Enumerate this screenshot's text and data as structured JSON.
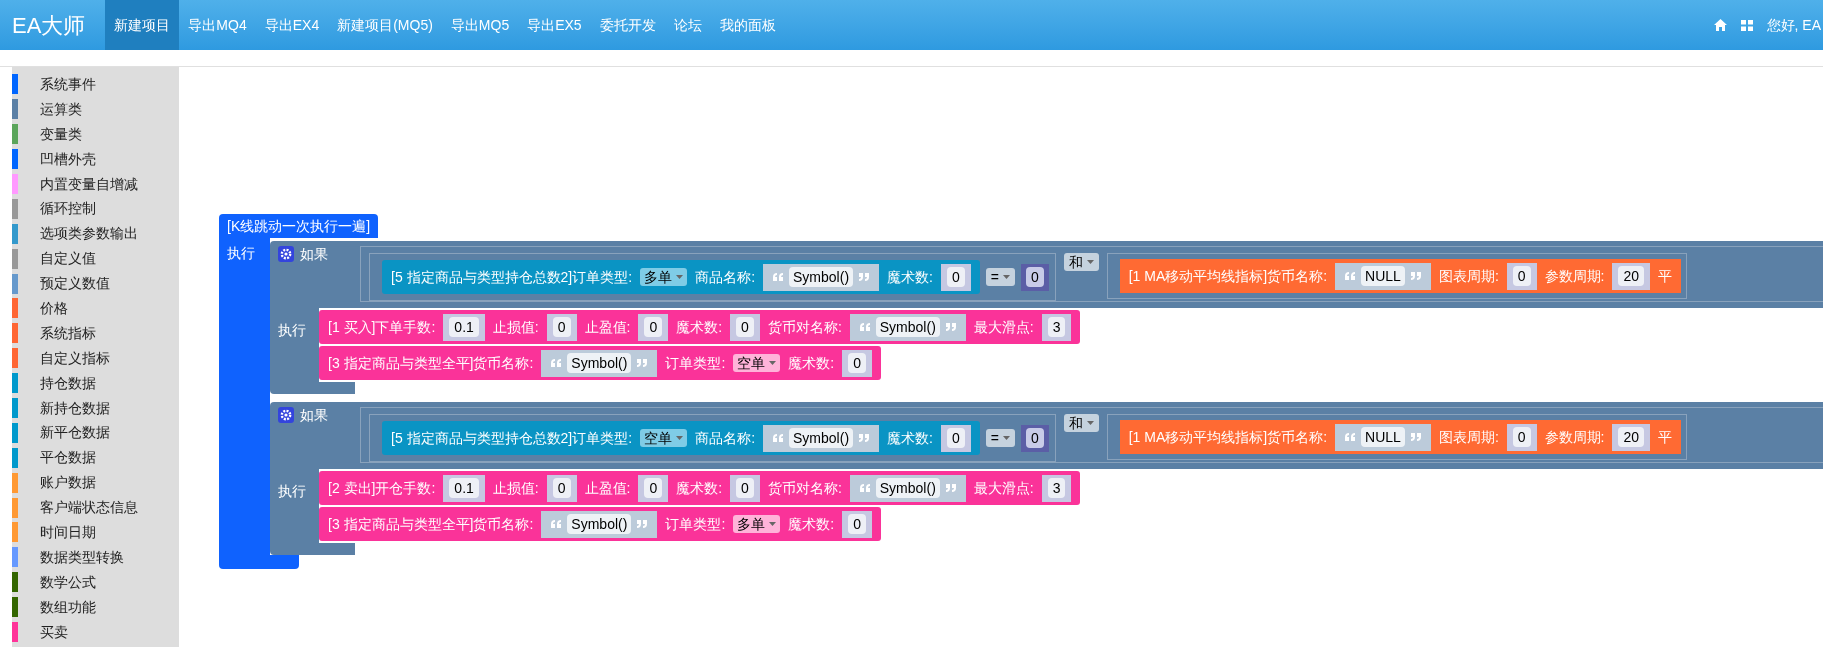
{
  "brand": "EA大师",
  "nav": [
    {
      "label": "新建项目",
      "selected": true
    },
    {
      "label": "导出MQ4",
      "selected": false
    },
    {
      "label": "导出EX4",
      "selected": false
    },
    {
      "label": "新建项目(MQ5)",
      "selected": false
    },
    {
      "label": "导出MQ5",
      "selected": false
    },
    {
      "label": "导出EX5",
      "selected": false
    },
    {
      "label": "委托开发",
      "selected": false
    },
    {
      "label": "论坛",
      "selected": false
    },
    {
      "label": "我的面板",
      "selected": false
    }
  ],
  "greeting": "您好, EA",
  "sidebar": {
    "items": [
      {
        "label": "系统事件",
        "color": "#0066ff"
      },
      {
        "label": "运算类",
        "color": "#5b80a5"
      },
      {
        "label": "变量类",
        "color": "#5ba55b"
      },
      {
        "label": "凹槽外壳",
        "color": "#0066ff"
      },
      {
        "label": "内置变量自增减",
        "color": "#ff99ff"
      },
      {
        "label": "循环控制",
        "color": "#999999"
      },
      {
        "label": "选项类参数输出",
        "color": "#3399cc"
      },
      {
        "label": "自定义值",
        "color": "#999999"
      },
      {
        "label": "预定义数值",
        "color": "#6699cc"
      },
      {
        "label": "价格",
        "color": "#ff6633"
      },
      {
        "label": "系统指标",
        "color": "#ff6633"
      },
      {
        "label": "自定义指标",
        "color": "#ff6633"
      },
      {
        "label": "持仓数据",
        "color": "#0099cc"
      },
      {
        "label": "新持仓数据",
        "color": "#0099cc"
      },
      {
        "label": "新平仓数据",
        "color": "#0099cc"
      },
      {
        "label": "平仓数据",
        "color": "#0099cc"
      },
      {
        "label": "账户数据",
        "color": "#ff9933"
      },
      {
        "label": "客户端状态信息",
        "color": "#ff9933"
      },
      {
        "label": "时间日期",
        "color": "#ff9933"
      },
      {
        "label": "数据类型转换",
        "color": "#6699ff"
      },
      {
        "label": "数学公式",
        "color": "#336600"
      },
      {
        "label": "数组功能",
        "color": "#336600"
      },
      {
        "label": "买卖",
        "color": "#ff3399"
      }
    ]
  },
  "workspace": {
    "event_block": {
      "title": "[K线跳动一次执行一遍]",
      "do_label": "执行",
      "statements": [
        {
          "if_label": "如果",
          "do_label": "执行",
          "condition": {
            "left": {
              "kind": "position",
              "parts": [
                {
                  "kind": "label",
                  "text": "[5 指定商品与类型持仓总数2]订单类型:"
                },
                {
                  "kind": "dropdown",
                  "text": "多单"
                },
                {
                  "kind": "label",
                  "text": "商品名称:"
                },
                {
                  "kind": "string",
                  "text": "Symbol()"
                },
                {
                  "kind": "label",
                  "text": "魔术数:"
                },
                {
                  "kind": "number",
                  "text": "0"
                }
              ]
            },
            "operator": "=",
            "value": "0",
            "join": "和",
            "right": {
              "kind": "indicator",
              "parts": [
                {
                  "kind": "label",
                  "text": "[1 MA移动平均线指标]货币名称:"
                },
                {
                  "kind": "string",
                  "text": "NULL"
                },
                {
                  "kind": "label",
                  "text": "图表周期:"
                },
                {
                  "kind": "number",
                  "text": "0"
                },
                {
                  "kind": "label",
                  "text": "参数周期:"
                },
                {
                  "kind": "number",
                  "text": "20"
                },
                {
                  "kind": "label",
                  "text": "平"
                }
              ]
            }
          },
          "actions": [
            {
              "kind": "order",
              "parts": [
                {
                  "kind": "label",
                  "text": "[1 买入]下单手数:"
                },
                {
                  "kind": "number",
                  "text": "0.1"
                },
                {
                  "kind": "label",
                  "text": "止损值:"
                },
                {
                  "kind": "number",
                  "text": "0"
                },
                {
                  "kind": "label",
                  "text": "止盈值:"
                },
                {
                  "kind": "number",
                  "text": "0"
                },
                {
                  "kind": "label",
                  "text": "魔术数:"
                },
                {
                  "kind": "number",
                  "text": "0"
                },
                {
                  "kind": "label",
                  "text": "货币对名称:"
                },
                {
                  "kind": "string",
                  "text": "Symbol()"
                },
                {
                  "kind": "label",
                  "text": "最大滑点:"
                },
                {
                  "kind": "number",
                  "text": "3"
                }
              ]
            },
            {
              "kind": "order",
              "parts": [
                {
                  "kind": "label",
                  "text": "[3 指定商品与类型全平]货币名称:"
                },
                {
                  "kind": "string",
                  "text": "Symbol()"
                },
                {
                  "kind": "label",
                  "text": "订单类型:"
                },
                {
                  "kind": "dropdown",
                  "text": "空单"
                },
                {
                  "kind": "label",
                  "text": "魔术数:"
                },
                {
                  "kind": "number",
                  "text": "0"
                }
              ]
            }
          ]
        },
        {
          "if_label": "如果",
          "do_label": "执行",
          "condition": {
            "left": {
              "kind": "position",
              "parts": [
                {
                  "kind": "label",
                  "text": "[5 指定商品与类型持仓总数2]订单类型:"
                },
                {
                  "kind": "dropdown",
                  "text": "空单"
                },
                {
                  "kind": "label",
                  "text": "商品名称:"
                },
                {
                  "kind": "string",
                  "text": "Symbol()"
                },
                {
                  "kind": "label",
                  "text": "魔术数:"
                },
                {
                  "kind": "number",
                  "text": "0"
                }
              ]
            },
            "operator": "=",
            "value": "0",
            "join": "和",
            "right": {
              "kind": "indicator",
              "parts": [
                {
                  "kind": "label",
                  "text": "[1 MA移动平均线指标]货币名称:"
                },
                {
                  "kind": "string",
                  "text": "NULL"
                },
                {
                  "kind": "label",
                  "text": "图表周期:"
                },
                {
                  "kind": "number",
                  "text": "0"
                },
                {
                  "kind": "label",
                  "text": "参数周期:"
                },
                {
                  "kind": "number",
                  "text": "20"
                },
                {
                  "kind": "label",
                  "text": "平"
                }
              ]
            }
          },
          "actions": [
            {
              "kind": "order",
              "parts": [
                {
                  "kind": "label",
                  "text": "[2 卖出]开仓手数:"
                },
                {
                  "kind": "number",
                  "text": "0.1"
                },
                {
                  "kind": "label",
                  "text": "止损值:"
                },
                {
                  "kind": "number",
                  "text": "0"
                },
                {
                  "kind": "label",
                  "text": "止盈值:"
                },
                {
                  "kind": "number",
                  "text": "0"
                },
                {
                  "kind": "label",
                  "text": "魔术数:"
                },
                {
                  "kind": "number",
                  "text": "0"
                },
                {
                  "kind": "label",
                  "text": "货币对名称:"
                },
                {
                  "kind": "string",
                  "text": "Symbol()"
                },
                {
                  "kind": "label",
                  "text": "最大滑点:"
                },
                {
                  "kind": "number",
                  "text": "3"
                }
              ]
            },
            {
              "kind": "order",
              "parts": [
                {
                  "kind": "label",
                  "text": "[3 指定商品与类型全平]货币名称:"
                },
                {
                  "kind": "string",
                  "text": "Symbol()"
                },
                {
                  "kind": "label",
                  "text": "订单类型:"
                },
                {
                  "kind": "dropdown",
                  "text": "多单"
                },
                {
                  "kind": "label",
                  "text": "魔术数:"
                },
                {
                  "kind": "number",
                  "text": "0"
                }
              ]
            }
          ]
        }
      ]
    }
  }
}
